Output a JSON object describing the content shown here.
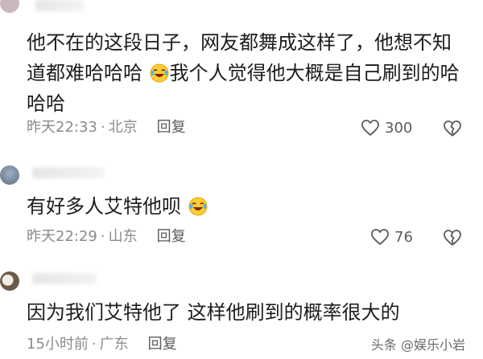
{
  "comments": [
    {
      "text_part1": "他不在的这段日子，网友都舞成这样了，他想不知道都难哈哈哈",
      "text_part2": "我个人觉得他大概是自己刷到的哈哈哈",
      "emoji": "laughing-tears-emoji",
      "time": "昨天22:33",
      "location": "北京",
      "reply_label": "回复",
      "likes": "300"
    },
    {
      "text_part1": "有好多人艾特他呗",
      "text_part2": "",
      "emoji": "laughing-tears-emoji",
      "time": "昨天22:29",
      "location": "山东",
      "reply_label": "回复",
      "likes": "76"
    },
    {
      "text_part1": "因为我们艾特他了 这样他刷到的概率很大的",
      "text_part2": "",
      "time": "15小时前",
      "location": "广东",
      "reply_label": "回复"
    }
  ],
  "separator": "·",
  "watermark": "头条 @娱乐小岩",
  "colors": {
    "text": "#1c1c1c",
    "meta": "#8a8a8a",
    "icon": "#5a5a5a",
    "emoji_face": "#ffcc33"
  }
}
